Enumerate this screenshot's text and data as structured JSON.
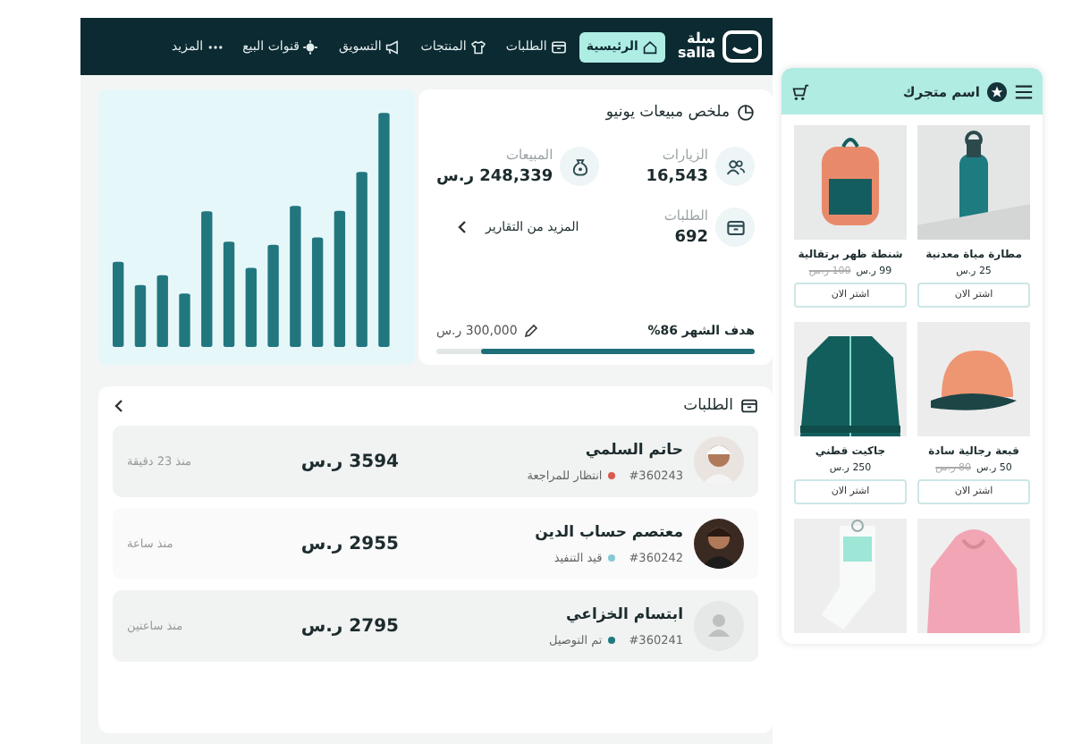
{
  "nav": {
    "logo": {
      "arabic": "سلة",
      "latin": "salla"
    },
    "items": [
      {
        "label": "الرئيسية",
        "kind": "home",
        "selected": true
      },
      {
        "label": "الطلبات",
        "kind": "box",
        "selected": false
      },
      {
        "label": "المنتجات",
        "kind": "shirt",
        "selected": false
      },
      {
        "label": "التسويق",
        "kind": "megaphone",
        "selected": false
      },
      {
        "label": "قنوات البيع",
        "kind": "channels",
        "selected": false
      },
      {
        "label": "المزيد",
        "kind": "dots",
        "selected": false
      }
    ]
  },
  "summary": {
    "title": "ملخص مبيعات يونيو",
    "stats": [
      {
        "label": "الزيارات",
        "value": "16,543",
        "kind": "users"
      },
      {
        "label": "المبيعات",
        "value": "248,339 ر.س",
        "kind": "moneybag"
      },
      {
        "label": "الطلبات",
        "value": "692",
        "kind": "box"
      }
    ],
    "more_link": "المزيد من التقارير",
    "goal": {
      "label": "هدف الشهر 86%",
      "target": "300,000 ر.س",
      "level": 0.86
    }
  },
  "orders": {
    "title": "الطلبات",
    "rows": [
      {
        "name": "حاتم السلمي",
        "order_id": "#360243",
        "status": "انتظار للمراجعة",
        "color": "#d9594c",
        "amount": "3594 ر.س",
        "time": "منذ 23 دقيقة"
      },
      {
        "name": "معتصم حساب الدين",
        "order_id": "#360242",
        "status": "قيد التنفيذ",
        "color": "#86c9d2",
        "amount": "2955 ر.س",
        "time": "منذ ساعة"
      },
      {
        "name": "ابتسام الخزاعي",
        "order_id": "#360241",
        "status": "تم التوصيل",
        "color": "#1f7a80",
        "amount": "2795 ر.س",
        "time": "منذ ساعتين",
        "kind": "placeholder"
      }
    ]
  },
  "store": {
    "name": "اسم متجرك",
    "products": [
      {
        "kind": "product",
        "name": "مطارة مياة معدنية",
        "price": "25 ر.س",
        "button": "اشتر الان"
      },
      {
        "kind": "product",
        "name": "شنطة ظهر برتقالية",
        "price": "99 ر.س",
        "old_price": "100 ر.س",
        "button": "اشتر الان"
      },
      {
        "kind": "product",
        "name": "قبعة رجالية سادة",
        "price": "50 ر.س",
        "old_price": "80 ر.س",
        "button": "اشتر الان"
      },
      {
        "kind": "product",
        "name": "جاكيت قطني",
        "price": "250 ر.س",
        "button": "اشتر الان"
      },
      {
        "kind": "picture"
      },
      {
        "kind": "picture"
      }
    ]
  }
}
